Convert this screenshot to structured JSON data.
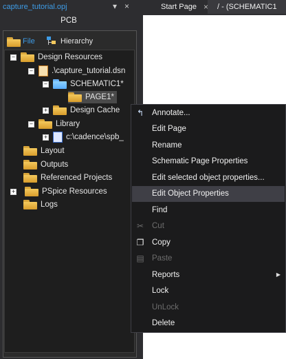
{
  "project_panel": {
    "title": "capture_tutorial.opj",
    "panel_label": "PCB",
    "tabs": [
      {
        "label": "File"
      },
      {
        "label": "Hierarchy"
      }
    ],
    "tree": [
      {
        "label": "Design Resources"
      },
      {
        "label": ".\\capture_tutorial.dsn"
      },
      {
        "label": "SCHEMATIC1*"
      },
      {
        "label": "PAGE1*"
      },
      {
        "label": "Design Cache"
      },
      {
        "label": "Library"
      },
      {
        "label": "c:\\cadence\\spb_"
      },
      {
        "label": "Layout"
      },
      {
        "label": "Outputs"
      },
      {
        "label": "Referenced Projects"
      },
      {
        "label": "PSpice Resources"
      },
      {
        "label": "Logs"
      }
    ]
  },
  "doc_tabs": [
    {
      "label": "Start Page"
    },
    {
      "label": "/ - (SCHEMATIC1"
    }
  ],
  "icons": {
    "dropdown": "▾",
    "close": "×"
  },
  "context_menu": {
    "items": [
      {
        "label": "Annotate...",
        "icon": "annotate-icon",
        "enabled": true
      },
      {
        "label": "Edit Page",
        "enabled": true
      },
      {
        "label": "Rename",
        "enabled": true
      },
      {
        "label": "Schematic Page Properties",
        "enabled": true
      },
      {
        "label": "Edit selected object properties...",
        "enabled": true
      },
      {
        "label": "Edit Object Properties",
        "enabled": true,
        "highlighted": true
      },
      {
        "label": "Find",
        "enabled": true
      },
      {
        "label": "Cut",
        "icon": "scissors-icon",
        "enabled": false
      },
      {
        "label": "Copy",
        "icon": "copy-icon",
        "enabled": true
      },
      {
        "label": "Paste",
        "icon": "paste-icon",
        "enabled": false
      },
      {
        "label": "Reports",
        "enabled": true,
        "submenu": true
      },
      {
        "label": "Lock",
        "enabled": true
      },
      {
        "label": "UnLock",
        "enabled": false
      },
      {
        "label": "Delete",
        "enabled": true
      }
    ]
  },
  "colors": {
    "accent": "#3e9ce6",
    "folder": "#f4c95d"
  }
}
